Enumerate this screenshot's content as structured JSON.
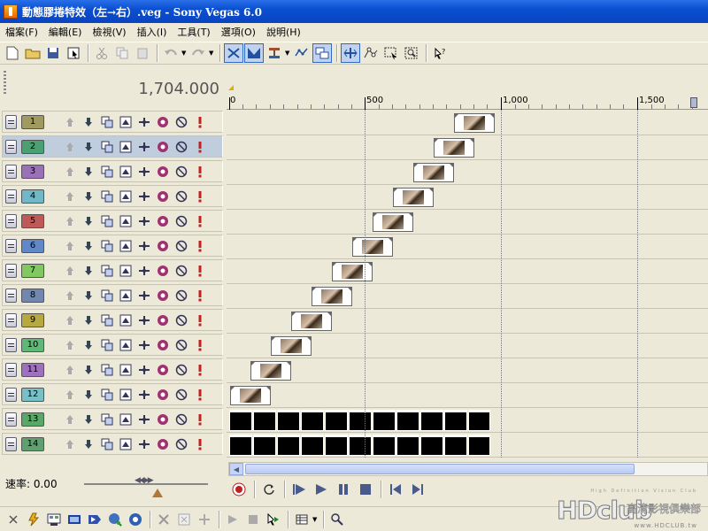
{
  "window": {
    "title": "動態膠捲特效（左→右）.veg - Sony Vegas 6.0"
  },
  "menu": [
    {
      "label": "檔案(F)"
    },
    {
      "label": "編輯(E)"
    },
    {
      "label": "檢視(V)"
    },
    {
      "label": "插入(I)"
    },
    {
      "label": "工具(T)"
    },
    {
      "label": "選項(O)"
    },
    {
      "label": "說明(H)"
    }
  ],
  "toolbar_icons": [
    "new-file-icon",
    "open-folder-icon",
    "save-icon",
    "properties-icon",
    "cut-icon",
    "copy-icon",
    "paste-icon",
    "undo-icon",
    "redo-icon",
    "snap-icon",
    "auto-crossfade-icon",
    "ripple-edit-icon",
    "lock-envelopes-icon",
    "ignore-grouping-icon",
    "normal-edit-tool-icon",
    "envelope-tool-icon",
    "selection-tool-icon",
    "zoom-tool-icon",
    "whats-this-icon"
  ],
  "timecode": "1,704.000",
  "ruler": {
    "labels": [
      "0",
      "500",
      "1,000",
      "1,500"
    ]
  },
  "colors": {
    "selected_row": "#bfcddd",
    "menu_bg": "#ece9d8",
    "titlebar": "#0a4fd0"
  },
  "tracks": [
    {
      "number": "1",
      "color": "#a09a60"
    },
    {
      "number": "2",
      "color": "#4aa070"
    },
    {
      "number": "3",
      "color": "#9a70b8"
    },
    {
      "number": "4",
      "color": "#70b8c8"
    },
    {
      "number": "5",
      "color": "#c05858"
    },
    {
      "number": "6",
      "color": "#6088c8"
    },
    {
      "number": "7",
      "color": "#80c860"
    },
    {
      "number": "8",
      "color": "#7088b0"
    },
    {
      "number": "9",
      "color": "#b8a840"
    },
    {
      "number": "10",
      "color": "#60b878"
    },
    {
      "number": "11",
      "color": "#a070c0"
    },
    {
      "number": "12",
      "color": "#78c0c8"
    },
    {
      "number": "13",
      "color": "#58a868"
    },
    {
      "number": "14",
      "color": "#60a070"
    }
  ],
  "track_icons": [
    "move-up-icon",
    "move-down-icon",
    "composite-mode-icon",
    "parent-mode-icon",
    "motion-blur-icon",
    "fx-icon",
    "mute-icon",
    "solo-icon"
  ],
  "rate": {
    "label": "速率: 0.00"
  },
  "transport_icons": [
    "record-icon",
    "loop-icon",
    "play-from-start-icon",
    "play-icon",
    "pause-icon",
    "stop-icon",
    "prev-marker-icon",
    "next-marker-icon"
  ],
  "bottom_toolbar_icons": [
    "explorer-icon",
    "media-icon",
    "trimmer-icon",
    "transitions-icon",
    "video-fx-icon",
    "media-generators-icon",
    "delete-icon",
    "remove-icon",
    "add-icon",
    "play-preview-icon",
    "stop-preview-icon",
    "auto-preview-icon",
    "views-icon",
    "search-icon"
  ],
  "watermark": {
    "top": "High Definition Vision Club",
    "logo": "HDclub",
    "sub": "高清影視俱樂部",
    "url": "www.HDCLUB.tw"
  }
}
